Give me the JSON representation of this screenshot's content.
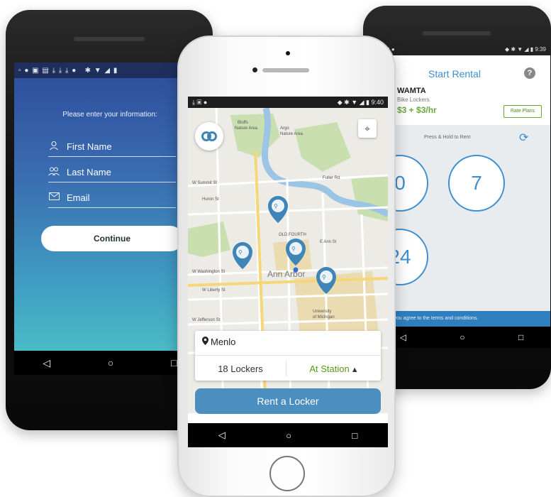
{
  "left_phone": {
    "prompt": "Please enter your information:",
    "fields": [
      {
        "label": "First Name",
        "icon": "person-icon"
      },
      {
        "label": "Last Name",
        "icon": "people-icon"
      },
      {
        "label": "Email",
        "icon": "mail-icon"
      }
    ],
    "continue_label": "Continue",
    "nav": {
      "back": "◁",
      "home": "○",
      "recent": "□"
    }
  },
  "center_phone": {
    "status": {
      "icons": "⤓ ▣ ●",
      "right": "◆ ✱ ▼ ◢ ▮ 9:40"
    },
    "map_labels": {
      "nature_area": "Bluffs\nNature Area",
      "argo_park": "Argo\nNature Area",
      "city": "Ann Arbor",
      "downtown": "OLD FOURTH\nWARD",
      "university": "University\nof Michigan",
      "street1": "W Summit St",
      "street2": "Huron St",
      "street3": "W Washington St",
      "street4": "W Liberty St",
      "street5": "W Jefferson St",
      "street6": "E Ann St",
      "street7": "Fuller Rd",
      "street8": "Observatory St"
    },
    "location_name": "Menlo",
    "lockers": "18 Lockers",
    "station": "At Station",
    "rent_label": "Rent a Locker",
    "nav": {
      "back": "◁",
      "home": "○",
      "recent": "□"
    },
    "colors": {
      "rent": "#4a8fc0",
      "station": "#5a9a1a",
      "marker": "#3f85b8"
    }
  },
  "right_phone": {
    "status": {
      "left": "▪ ▪ ▣ ●",
      "right": "◆ ✱ ▼ ◢ ▮ 9:39"
    },
    "title": "Start Rental",
    "org_logo": "M",
    "org_name": "WAMTA",
    "org_sub": "Bike Lockers",
    "price": "$3 + $3/hr",
    "rate_plans": "Rate Plans",
    "hold_label": "Press & Hold to Rent",
    "options": [
      "0",
      "7",
      "24"
    ],
    "terms": "renting you agree to the terms and conditions.",
    "nav": {
      "back": "◁",
      "home": "○",
      "recent": "□"
    }
  }
}
